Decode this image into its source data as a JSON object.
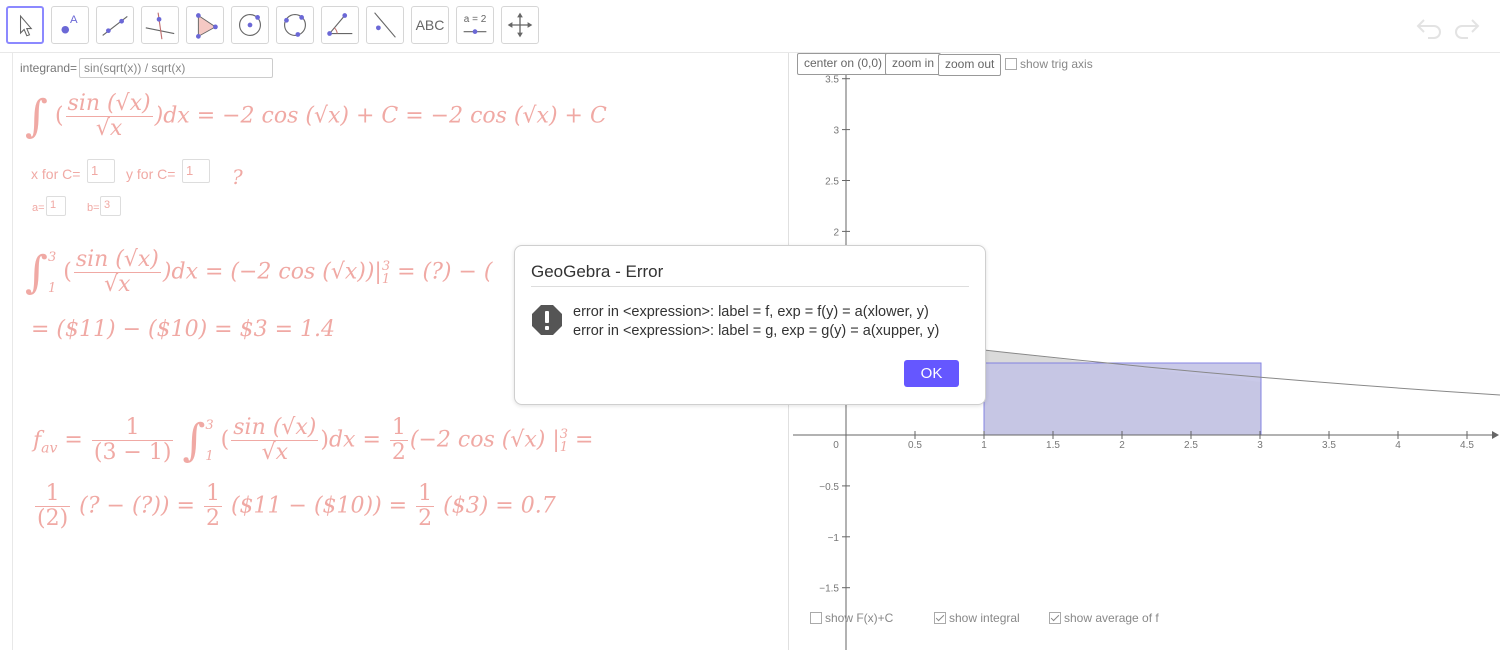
{
  "toolbar": {
    "tools": [
      "move-tool",
      "point-tool",
      "line-tool",
      "perpendicular-line-tool",
      "polygon-tool",
      "circle-tool",
      "conic-tool",
      "angle-tool",
      "reflect-tool",
      "text-tool",
      "slider-tool",
      "move-graphics-view-tool"
    ],
    "text_tool_label": "ABC",
    "slider_tool_label": "a = 2"
  },
  "algebra": {
    "integrand_label": "integrand=",
    "integrand_value": "sin(sqrt(x)) / sqrt(x)",
    "x_for_c_label": "x for C=",
    "x_for_c_value": "1",
    "y_for_c_label": "y for C=",
    "y_for_c_value": "1",
    "question_mark": "?",
    "a_label": "a=",
    "a_value": "1",
    "b_label": "b=",
    "b_value": "3",
    "eq1_int": "∫",
    "eq1_num": "sin (√x)",
    "eq1_den": "√x",
    "eq1_rest": ")dx = −2  cos (√x) + C = −2  cos (√x) + C",
    "eq2_upper": "3",
    "eq2_lower": "1",
    "eq2_rest": ")dx = (−2  cos (√x))|",
    "eq2_bar_upper": "3",
    "eq2_bar_lower": "1",
    "eq2_tail": " = (?) − (",
    "eq3": "= ($11) − ($10) = $3 = 1.4",
    "eq4_f": "f",
    "eq4_sub": "av",
    "eq4_one": "1",
    "eq4_den": "(3 − 1)",
    "eq4_half_num": "1",
    "eq4_half_den": "2",
    "eq4_rest": "(−2  cos (√x) |",
    "eq4_eq": " =",
    "eq5_one": "1",
    "eq5_two": "(2)",
    "eq5_rest1": "(? − (?)) =",
    "eq5_rest2": "($11 − ($10)) =",
    "eq5_rest3": "($3) = 0.7"
  },
  "graphics": {
    "center_button": "center on (0,0)",
    "zoom_in_button": "zoom in",
    "zoom_out_button": "zoom out",
    "show_trig_axis": "show trig axis",
    "x_ticks": [
      "0",
      "0.5",
      "1",
      "1.5",
      "2",
      "2.5",
      "3",
      "3.5",
      "4",
      "4.5"
    ],
    "y_ticks": [
      "3.5",
      "3",
      "2.5",
      "2",
      "-0.5",
      "-1",
      "-1.5"
    ],
    "checkbox_fx": "show F(x)+C",
    "checkbox_integral": "show integral",
    "checkbox_average": "show average of f",
    "fx_checked": false,
    "integral_checked": true,
    "average_checked": true
  },
  "dialog": {
    "title": "GeoGebra - Error",
    "line1": "error in <expression>: label = f, exp = f(y) = a(xlower, y)",
    "line2": "error in <expression>: label = g, exp = g(y) = a(xupper, y)",
    "ok": "OK"
  },
  "colors": {
    "accent": "#6557ff",
    "math_text": "#f0a9a4",
    "shade_rect": "#c4c4e6",
    "shade_integral": "#d6d6d6"
  }
}
